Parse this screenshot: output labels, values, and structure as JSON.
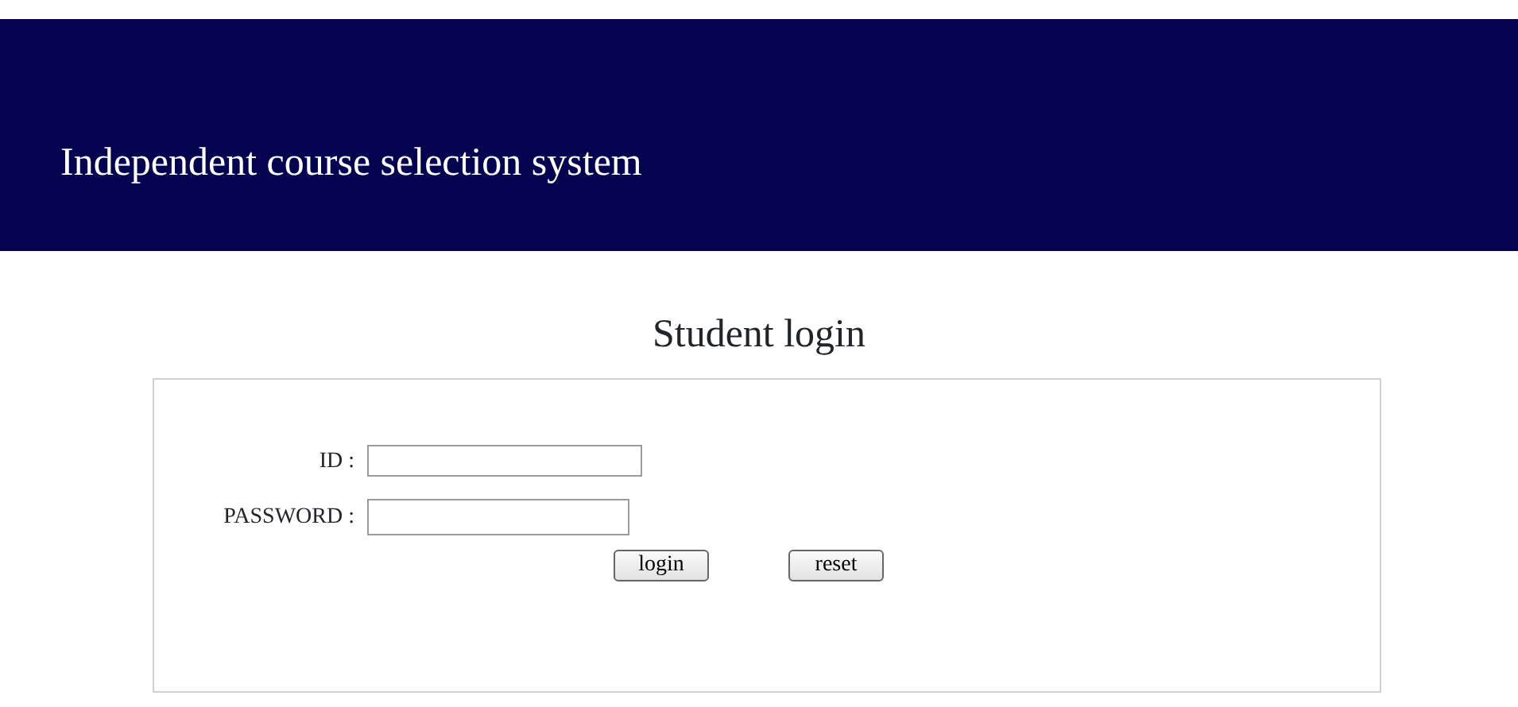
{
  "header": {
    "title": "Independent course selection system"
  },
  "heading": "Student login",
  "form": {
    "fields": [
      {
        "label": "ID :",
        "kind": "text"
      },
      {
        "label": "PASSWORD :",
        "kind": "password"
      }
    ],
    "buttons": [
      {
        "label": "login"
      },
      {
        "label": "reset"
      }
    ]
  }
}
